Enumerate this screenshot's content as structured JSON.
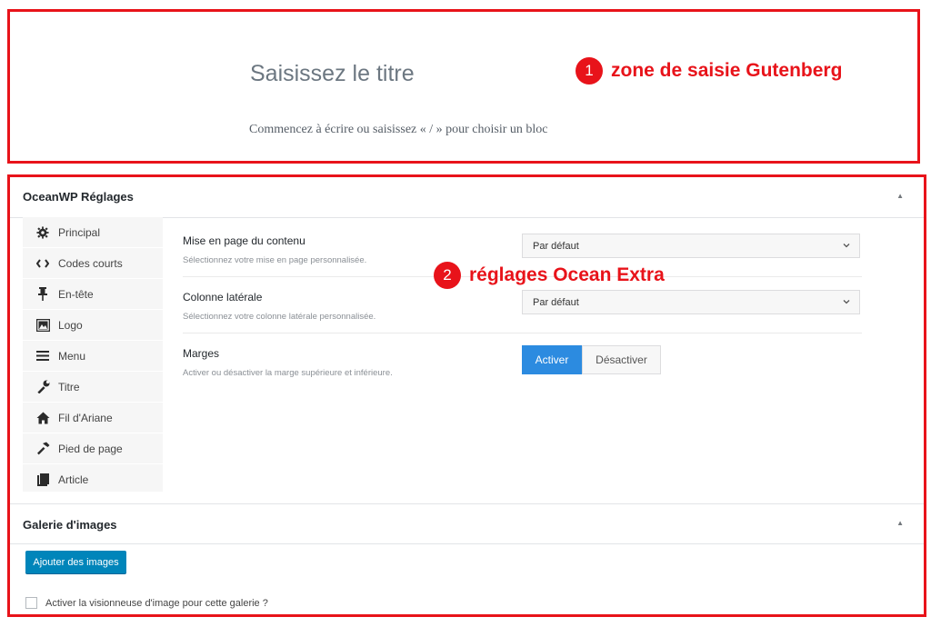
{
  "gutenberg": {
    "title_placeholder": "Saisissez le titre",
    "block_hint": "Commencez à écrire ou saisissez « / » pour choisir un bloc"
  },
  "annotations": [
    {
      "number": "1",
      "text": "zone de saisie Gutenberg"
    },
    {
      "number": "2",
      "text": "réglages Ocean Extra"
    }
  ],
  "oceanwp": {
    "title": "OceanWP Réglages",
    "nav": [
      {
        "icon": "gear-icon",
        "label": "Principal"
      },
      {
        "icon": "code-icon",
        "label": "Codes courts"
      },
      {
        "icon": "pin-icon",
        "label": "En-tête"
      },
      {
        "icon": "image-icon",
        "label": "Logo"
      },
      {
        "icon": "menu-icon",
        "label": "Menu"
      },
      {
        "icon": "wrench-icon",
        "label": "Titre"
      },
      {
        "icon": "home-icon",
        "label": "Fil d'Ariane"
      },
      {
        "icon": "hammer-icon",
        "label": "Pied de page"
      },
      {
        "icon": "book-icon",
        "label": "Article"
      }
    ],
    "fields": [
      {
        "label": "Mise en page du contenu",
        "description": "Sélectionnez votre mise en page personnalisée.",
        "value": "Par défaut"
      },
      {
        "label": "Colonne latérale",
        "description": "Sélectionnez votre colonne latérale personnalisée.",
        "value": "Par défaut"
      },
      {
        "label": "Marges",
        "description": "Activer ou désactiver la marge supérieure et inférieure.",
        "on_label": "Activer",
        "off_label": "Désactiver",
        "selected": "Activer"
      }
    ]
  },
  "gallery": {
    "title": "Galerie d'images",
    "add_button": "Ajouter des images",
    "lightbox_label": "Activer la visionneuse d'image pour cette galerie ?",
    "lightbox_checked": false
  },
  "colors": {
    "annotation": "#e8131a",
    "active_button": "#2c8be0",
    "primary_button": "#0085ba"
  }
}
